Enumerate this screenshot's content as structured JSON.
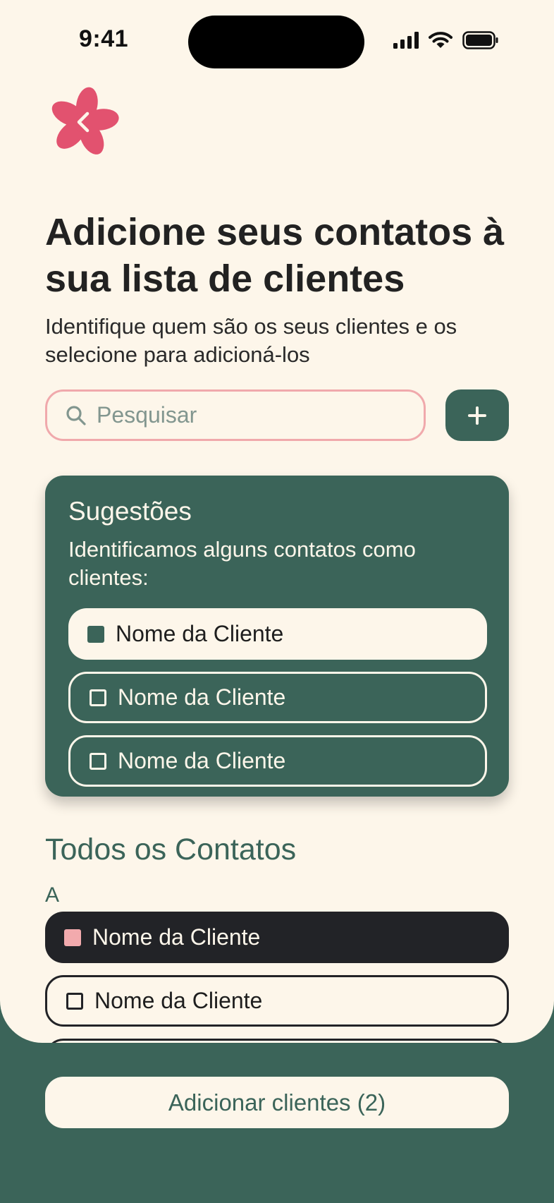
{
  "status_bar": {
    "time": "9:41"
  },
  "header": {
    "title": "Adicione seus contatos à sua lista de clientes",
    "subtitle": "Identifique quem são os seus clientes e os selecione para adicioná-los"
  },
  "search": {
    "placeholder": "Pesquisar",
    "value": ""
  },
  "suggestions": {
    "title": "Sugestões",
    "description": "Identificamos alguns contatos como clientes:",
    "items": [
      {
        "label": "Nome da Cliente",
        "selected": true
      },
      {
        "label": "Nome da Cliente",
        "selected": false
      },
      {
        "label": "Nome da Cliente",
        "selected": false
      }
    ]
  },
  "contacts": {
    "title": "Todos os Contatos",
    "group_letter": "A",
    "items": [
      {
        "label": "Nome da Cliente",
        "selected": true
      },
      {
        "label": "Nome da Cliente",
        "selected": false
      },
      {
        "label": "",
        "selected": false
      }
    ]
  },
  "footer": {
    "button_label": "Adicionar clientes (2)"
  },
  "colors": {
    "background": "#fdf6ea",
    "primary_green": "#3b6459",
    "accent_pink": "#e2526f",
    "soft_pink": "#f2aaad",
    "dark": "#222327"
  },
  "icons": {
    "back": "flower-back-icon",
    "search": "search-icon",
    "add": "plus-icon"
  }
}
